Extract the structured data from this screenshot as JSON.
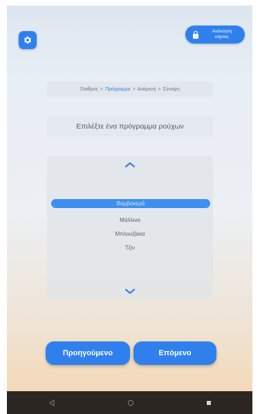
{
  "lock_button": {
    "label": "Ανάκτηση\nκάρτας",
    "icon": "lock-icon"
  },
  "settings_button": {
    "icon": "gear-icon"
  },
  "breadcrumb": {
    "items": [
      "Σταθμος",
      "Πρόγραμμα",
      "Ανάμενή",
      "Σύνοψη"
    ],
    "separator": ">",
    "active_index": 1
  },
  "prompt": "Επιλέξτε ένα πρόγραμμα ρούχων",
  "picker": {
    "up_icon": "chevron-up-icon",
    "down_icon": "chevron-down-icon",
    "items": [
      "Βαμβακερά",
      "Μάλλινα",
      "Μπλουζάκια",
      "Τζιν"
    ],
    "selected_index": 0
  },
  "buttons": {
    "previous": "Προηγούμενο",
    "next": "Επόμενο"
  },
  "nav_bar": {
    "back_icon": "back-triangle-icon",
    "home_icon": "home-circle-icon",
    "recents_icon": "recents-square-icon"
  },
  "colors": {
    "accent": "#2f80ed",
    "nav_bar": "#2b2622"
  }
}
